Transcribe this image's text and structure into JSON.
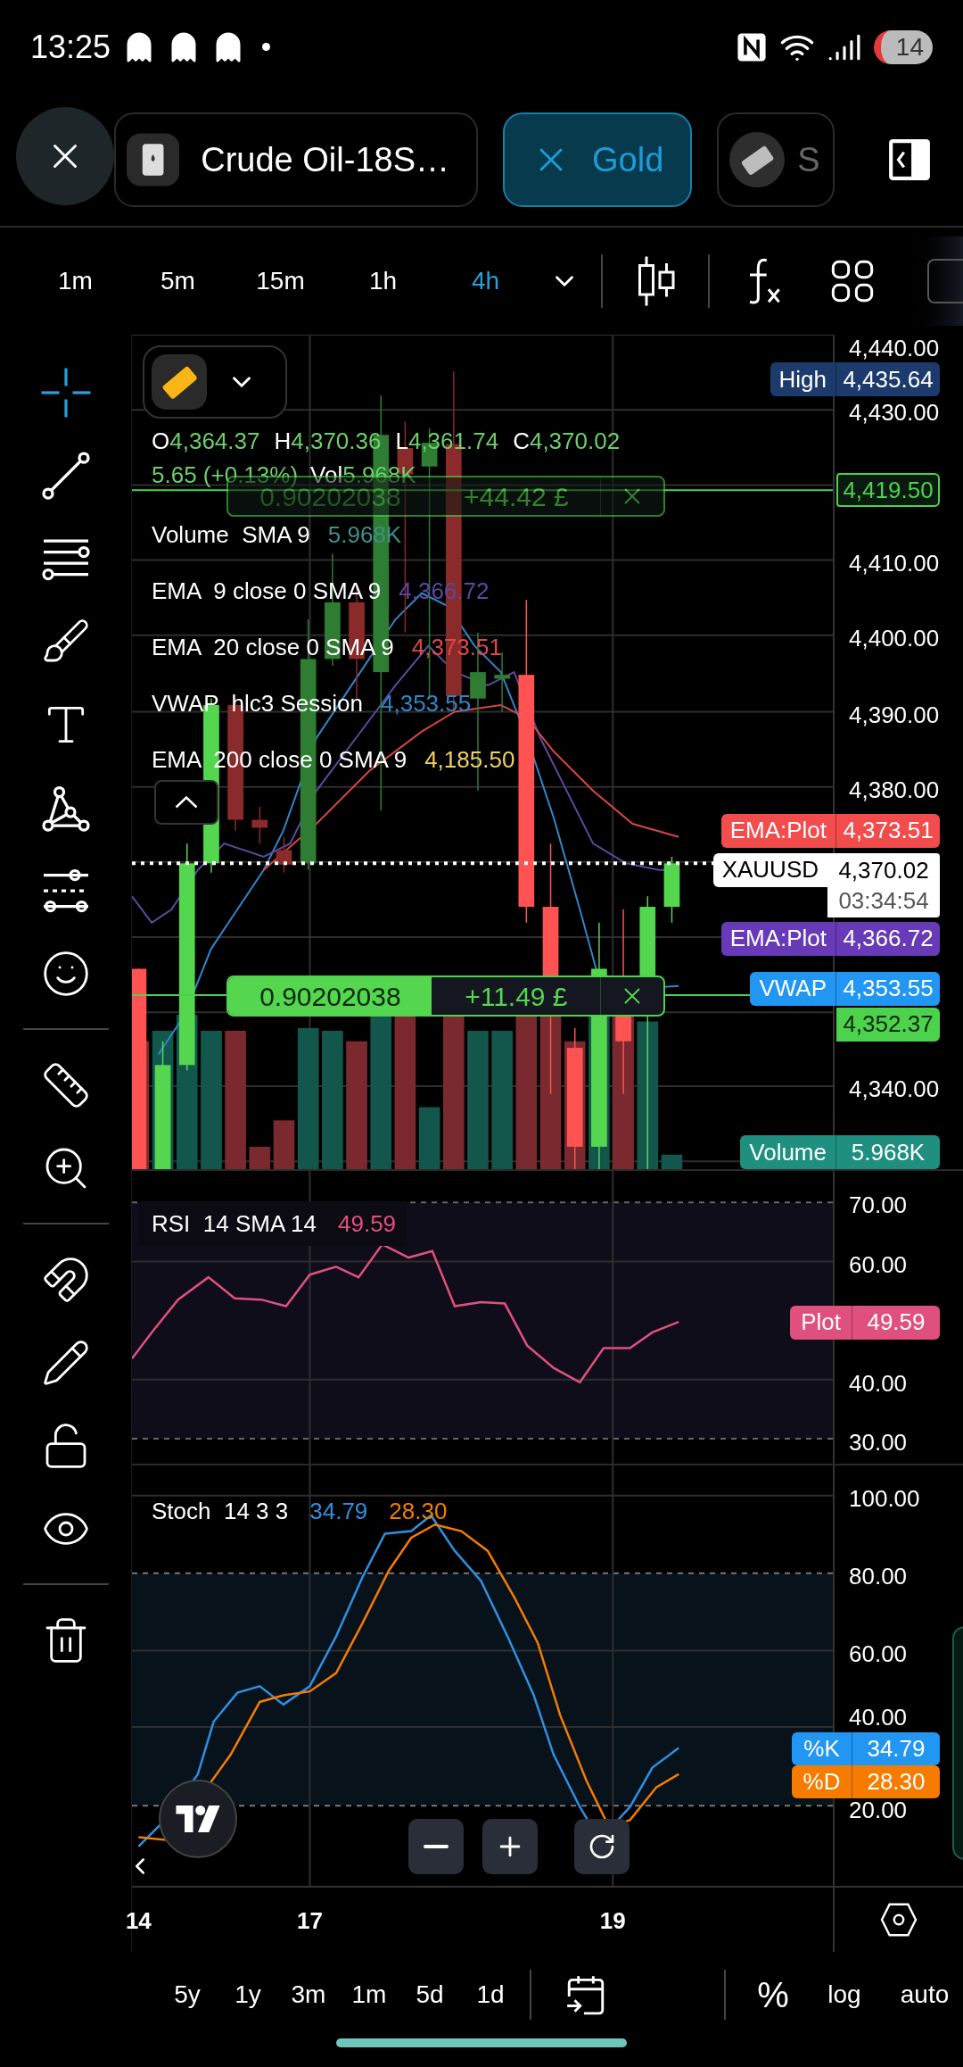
{
  "status_bar": {
    "time": "13:25",
    "battery": "14"
  },
  "tabs": [
    {
      "label": "Crude Oil-18S…",
      "selected": false
    },
    {
      "label": "Gold",
      "selected": true
    },
    {
      "label": "S",
      "selected": false
    }
  ],
  "timeframes": [
    {
      "label": "1m",
      "selected": false
    },
    {
      "label": "5m",
      "selected": false
    },
    {
      "label": "15m",
      "selected": false
    },
    {
      "label": "1h",
      "selected": false
    },
    {
      "label": "4h",
      "selected": true
    }
  ],
  "legend": {
    "ohlc": [
      {
        "label": "O",
        "value": "4,364.37"
      },
      {
        "label": "H",
        "value": "4,370.36"
      },
      {
        "label": "L",
        "value": "4,361.74"
      },
      {
        "label": "C",
        "value": "4,370.02"
      }
    ],
    "change": "5.65 (+0.13%)",
    "volume_label": "Vol",
    "volume": "5.968K",
    "indicators": [
      {
        "name": "Volume  SMA 9",
        "value": "5.968K",
        "color": "#3f8f8a"
      },
      {
        "name": "EMA  9 close 0 SMA 9",
        "value": "4,366.72",
        "color": "#5b4a9e"
      },
      {
        "name": "EMA  20 close 0 SMA 9",
        "value": "4,373.51",
        "color": "#e04848"
      },
      {
        "name": "VWAP  hlc3 Session",
        "value": "4,353.55",
        "color": "#2f86c8"
      },
      {
        "name": "EMA  200 close 0 SMA 9",
        "value": "4,185.50",
        "color": "#f0d060"
      }
    ]
  },
  "positions": [
    {
      "quantity": "0.90202038",
      "pnl": "+44.42 £",
      "faded": true
    },
    {
      "quantity": "0.90202038",
      "pnl": "+11.49 £",
      "faded": false
    }
  ],
  "price_axis": {
    "ticks": [
      "4,440.00",
      "4,430.00",
      "4,410.00",
      "4,400.00",
      "4,390.00",
      "4,380.00",
      "4,340.00"
    ],
    "tags": [
      {
        "kind": "solid",
        "label": "High",
        "value": "4,435.64",
        "color": "#1c3a6b"
      },
      {
        "kind": "outline",
        "value": "4,419.50",
        "color": "#4cd24c"
      },
      {
        "kind": "solid",
        "label": "EMA:Plot",
        "value": "4,373.51",
        "color": "#f24c4c"
      },
      {
        "kind": "last",
        "label": "XAUUSD",
        "value": "4,370.02",
        "countdown": "03:34:54"
      },
      {
        "kind": "solid",
        "label": "EMA:Plot",
        "value": "4,366.72",
        "color": "#673ab7"
      },
      {
        "kind": "solid",
        "label": "VWAP",
        "value": "4,353.55",
        "color": "#2196f3"
      },
      {
        "kind": "solid",
        "value": "4,352.37",
        "color": "#4cd24c",
        "dark_text": true
      },
      {
        "kind": "solid",
        "label": "Volume",
        "value": "5.968K",
        "color": "#1f8f7f"
      }
    ]
  },
  "rsi": {
    "legend": "RSI  14 SMA 14",
    "value": "49.59",
    "ticks": [
      "70.00",
      "60.00",
      "40.00",
      "30.00"
    ],
    "tag": {
      "label": "Plot",
      "value": "49.59",
      "color": "#e0507e"
    }
  },
  "stoch": {
    "legend": "Stoch  14 3 3",
    "k": "34.79",
    "d": "28.30",
    "ticks": [
      "100.00",
      "80.00",
      "60.00",
      "40.00",
      "20.00"
    ],
    "tags": [
      {
        "label": "%K",
        "value": "34.79",
        "color": "#2196f3"
      },
      {
        "label": "%D",
        "value": "28.30",
        "color": "#f57c00"
      }
    ]
  },
  "time_axis": [
    "14",
    "17",
    "19"
  ],
  "ranges": [
    "5y",
    "1y",
    "3m",
    "1m",
    "5d",
    "1d"
  ],
  "scale_options": [
    "%",
    "log",
    "auto"
  ]
}
